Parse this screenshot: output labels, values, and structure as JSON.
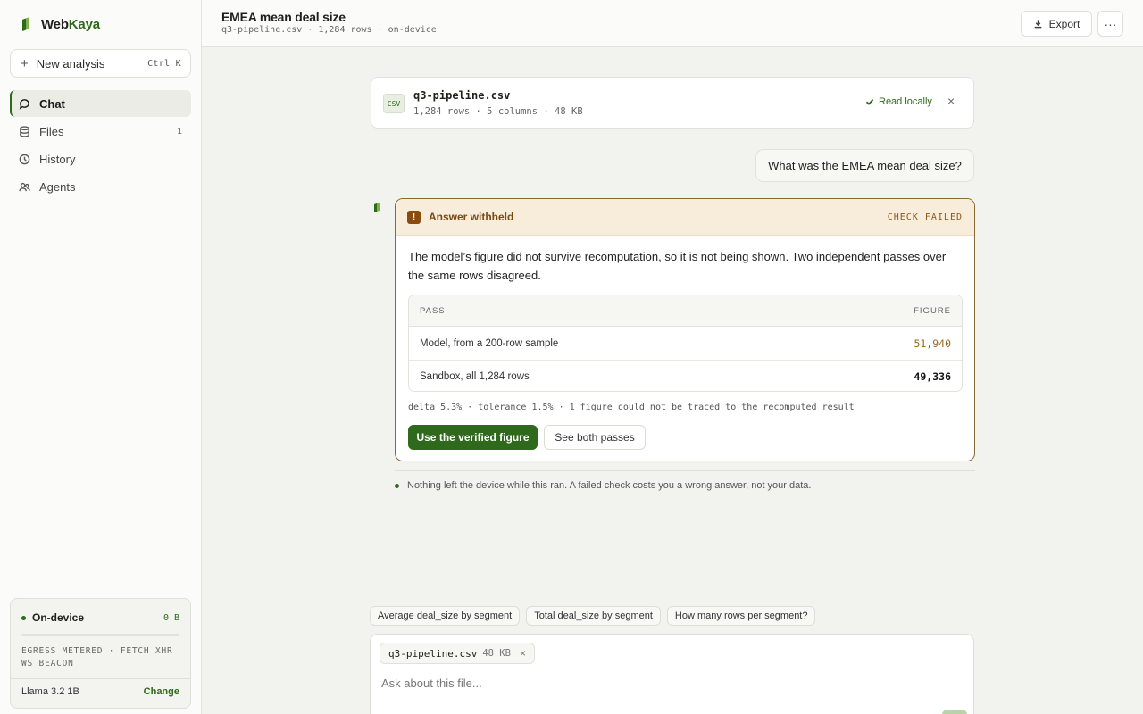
{
  "brand": {
    "name_prefix": "Web",
    "name_suffix": "Kaya"
  },
  "sidebar": {
    "new_analysis": {
      "label": "New analysis",
      "shortcut": "Ctrl K"
    },
    "items": [
      {
        "label": "Chat",
        "icon": "chat-bubble-icon",
        "active": true
      },
      {
        "label": "Files",
        "icon": "database-icon",
        "count": "1"
      },
      {
        "label": "History",
        "icon": "clock-icon"
      },
      {
        "label": "Agents",
        "icon": "people-icon"
      }
    ],
    "device": {
      "label": "On-device",
      "bytes": "0 B",
      "egress_line1": "EGRESS METERED · FETCH XHR",
      "egress_line2": "WS BEACON",
      "model": "Llama 3.2 1B",
      "change": "Change"
    }
  },
  "header": {
    "title": "EMEA mean deal size",
    "subtitle": "q3-pipeline.csv · 1,284 rows · on-device",
    "export_label": "Export",
    "more_label": "···"
  },
  "file_card": {
    "badge": "CSV",
    "name": "q3-pipeline.csv",
    "meta": "1,284 rows · 5 columns · 48 KB",
    "status": "Read locally",
    "close": "×"
  },
  "user_message": "What was the EMEA mean deal size?",
  "withheld": {
    "title": "Answer withheld",
    "status": "CHECK FAILED",
    "body": "The model’s figure did not survive recomputation, so it is not being shown. Two independent passes over the same rows disagreed.",
    "table": {
      "headers": [
        "PASS",
        "FIGURE"
      ],
      "rows": [
        {
          "pass": "Model, from a 200-row sample",
          "figure": "51,940"
        },
        {
          "pass": "Sandbox, all 1,284 rows",
          "figure": "49,336"
        }
      ]
    },
    "delta": "delta 5.3% · tolerance 1.5% · 1 figure could not be traced to the recomputed result",
    "primary_button": "Use the verified figure",
    "secondary_button": "See both passes"
  },
  "footer_note": "Nothing left the device while this ran. A failed check costs you a wrong answer, not your data.",
  "suggestions": [
    "Average deal_size by segment",
    "Total deal_size by segment",
    "How many rows per segment?"
  ],
  "composer": {
    "attachment_name": "q3-pipeline.csv",
    "attachment_size": "48 KB",
    "placeholder": "Ask about this file..."
  },
  "colors": {
    "accent": "#2f6a1c",
    "warning": "#8a4b10",
    "warning_bg": "#f8ecdb"
  }
}
